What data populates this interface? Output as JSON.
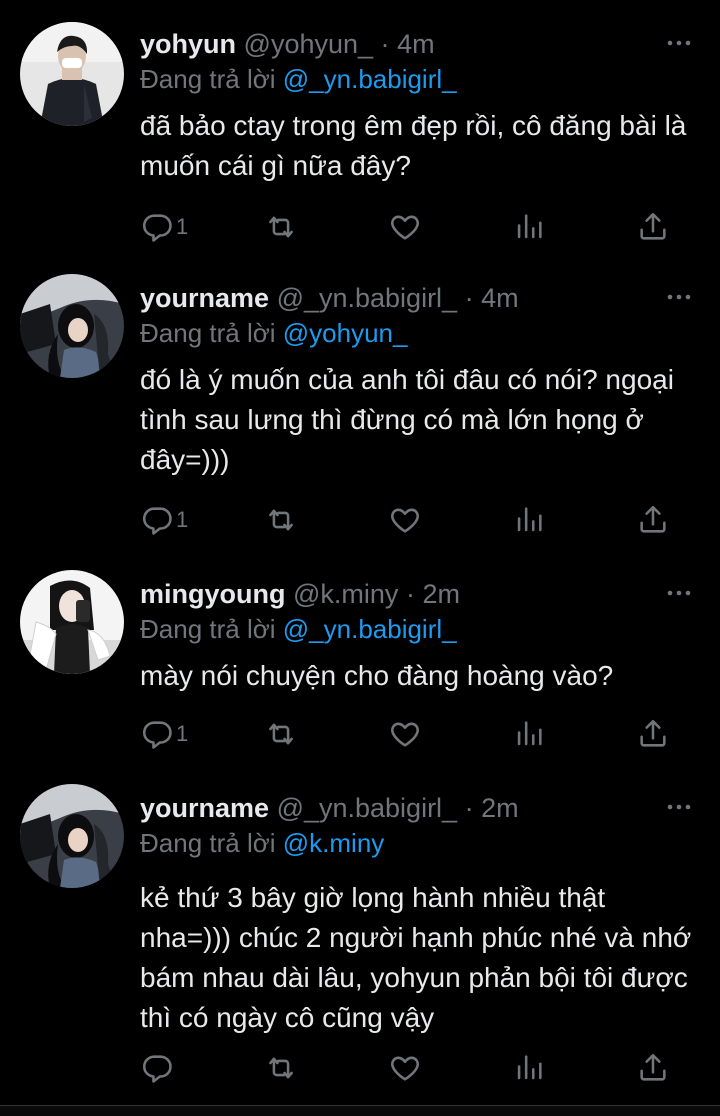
{
  "tweets": [
    {
      "name": "yohyun",
      "handle": "@yohyun_",
      "dot": "·",
      "time": "4m",
      "replying_prefix": "Đang trả lời ",
      "replying_to": "@_yn.babigirl_",
      "text": "đã bảo ctay trong êm đẹp rồi, cô đăng bài là muốn cái gì nữa đây?",
      "reply_count": "1",
      "avatar_icon": "profile-photo-man-jacket"
    },
    {
      "name": "yourname",
      "handle": "@_yn.babigirl_",
      "dot": "·",
      "time": "4m",
      "replying_prefix": "Đang trả lời ",
      "replying_to": "@yohyun_",
      "text": "đó là ý muốn của anh tôi đâu có nói? ngoại tình sau lưng thì đừng có mà lớn họng ở đây=)))",
      "reply_count": "1",
      "avatar_icon": "profile-photo-girl-car"
    },
    {
      "name": "mingyoung",
      "handle": "@k.miny",
      "dot": "·",
      "time": "2m",
      "replying_prefix": "Đang trả lời ",
      "replying_to": "@_yn.babigirl_",
      "text": "mày nói chuyện cho đàng hoàng vào?",
      "reply_count": "1",
      "avatar_icon": "profile-photo-girl-mirror-selfie"
    },
    {
      "name": "yourname",
      "handle": "@_yn.babigirl_",
      "dot": "·",
      "time": "2m",
      "replying_prefix": "Đang trả lời ",
      "replying_to": "@k.miny",
      "text": "kẻ thứ 3 bây giờ lọng hành nhiều thật nha=))) chúc 2 người hạnh phúc nhé và nhớ bám nhau dài lâu, yohyun phản bội tôi được thì có ngày cô cũng vậy",
      "reply_count": "",
      "avatar_icon": "profile-photo-girl-car"
    }
  ],
  "colors": {
    "background": "#000000",
    "primary_text": "#e7e9ea",
    "secondary_text": "#71767b",
    "mention": "#1d9bf0"
  },
  "icons": [
    "reply-icon",
    "retweet-icon",
    "like-icon",
    "views-icon",
    "share-icon",
    "more-icon"
  ]
}
